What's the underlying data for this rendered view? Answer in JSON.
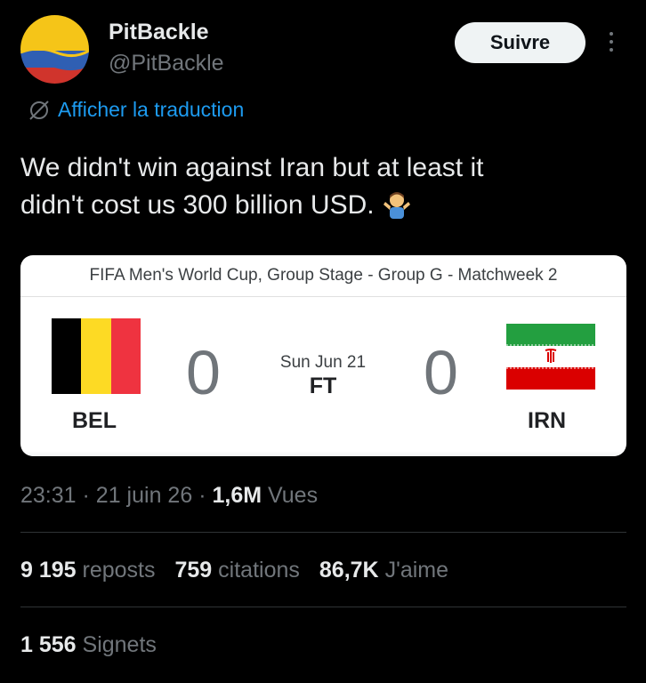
{
  "author": {
    "display_name": "PitBackle",
    "handle": "@PitBackle",
    "avatar_icon": "colombia-flag-avatar"
  },
  "follow_button": {
    "label": "Suivre"
  },
  "more_menu": {
    "icon": "more-vertical-icon"
  },
  "translate": {
    "label": "Afficher la traduction",
    "icon": "globe-slash-icon"
  },
  "tweet": {
    "lines": [
      "We didn't win against Iran but at least it",
      "didn't cost us 300 billion USD."
    ],
    "emoji": "person-shrugging-emoji"
  },
  "match_card": {
    "header": "FIFA Men's World Cup, Group Stage - Group G - Matchweek 2",
    "home": {
      "abbr": "BEL",
      "score": "0",
      "flag": "belgium-flag"
    },
    "away": {
      "abbr": "IRN",
      "score": "0",
      "flag": "iran-flag"
    },
    "date": "Sun Jun 21",
    "status": "FT"
  },
  "meta": {
    "time": "23:31",
    "date": "21 juin 26",
    "views_count": "1,6M",
    "views_label": "Vues"
  },
  "stats": {
    "reposts_count": "9 195",
    "reposts_label": "reposts",
    "quotes_count": "759",
    "quotes_label": "citations",
    "likes_count": "86,7K",
    "likes_label": "J'aime"
  },
  "bookmarks": {
    "count": "1 556",
    "label": "Signets"
  },
  "colors": {
    "background": "#000000",
    "text_primary": "#e7e9ea",
    "text_secondary": "#71767b",
    "link": "#1d9bf0",
    "divider": "#2f3336"
  }
}
